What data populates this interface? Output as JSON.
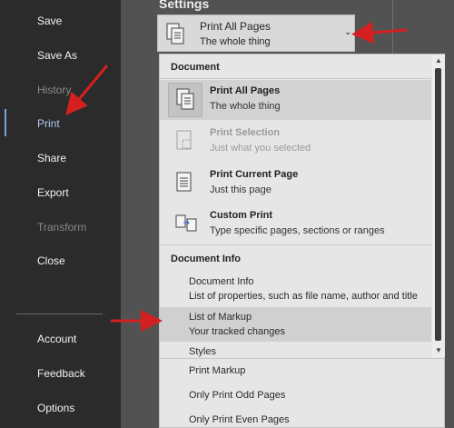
{
  "sidebar": {
    "items": [
      {
        "label": "Save"
      },
      {
        "label": "Save As"
      },
      {
        "label": "History"
      },
      {
        "label": "Print"
      },
      {
        "label": "Share"
      },
      {
        "label": "Export"
      },
      {
        "label": "Transform"
      },
      {
        "label": "Close"
      }
    ],
    "bottom_items": [
      {
        "label": "Account"
      },
      {
        "label": "Feedback"
      },
      {
        "label": "Options"
      }
    ]
  },
  "settings": {
    "heading": "Settings",
    "selected_title": "Print All Pages",
    "selected_desc": "The whole thing"
  },
  "dropdown": {
    "document_header": "Document",
    "options": [
      {
        "title": "Print All Pages",
        "desc": "The whole thing",
        "icon": "pages-icon"
      },
      {
        "title": "Print Selection",
        "desc": "Just what you selected",
        "icon": "selection-icon"
      },
      {
        "title": "Print Current Page",
        "desc": "Just this page",
        "icon": "page-icon"
      },
      {
        "title": "Custom Print",
        "desc": "Type specific pages, sections or ranges",
        "icon": "custom-print-icon"
      }
    ],
    "document_info_header": "Document Info",
    "info_items": [
      {
        "title": "Document Info",
        "desc": "List of properties, such as file name, author and title"
      },
      {
        "title": "List of Markup",
        "desc": "Your tracked changes"
      },
      {
        "title": "Styles",
        "desc": ""
      }
    ],
    "lower_items": [
      {
        "label": "Print Markup"
      },
      {
        "label": "Only Print Odd Pages"
      },
      {
        "label": "Only Print Even Pages"
      }
    ]
  },
  "colors": {
    "annotation_arrow": "#d42020",
    "active_nav": "#b3c8ee"
  }
}
